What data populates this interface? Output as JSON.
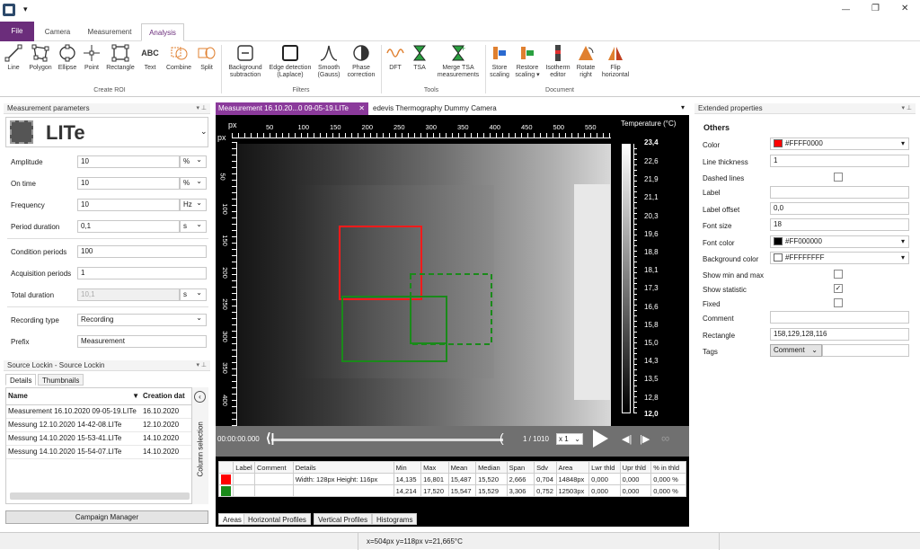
{
  "app": {
    "logo": "app-logo-icon",
    "quick": "▾",
    "controls": {
      "min": "—",
      "max": "❐",
      "close": "✕"
    }
  },
  "menu_tabs": [
    {
      "label": "File"
    },
    {
      "label": "Camera"
    },
    {
      "label": "Measurement"
    },
    {
      "label": "Analysis"
    }
  ],
  "ribbon": {
    "roi": [
      {
        "label": "Line",
        "icon": "line-icon"
      },
      {
        "label": "Polygon",
        "icon": "polygon-icon"
      },
      {
        "label": "Ellipse",
        "icon": "ellipse-icon"
      },
      {
        "label": "Point",
        "icon": "point-icon"
      },
      {
        "label": "Rectangle",
        "icon": "rectangle-icon"
      },
      {
        "label": "Text",
        "icon": "text-icon",
        "glyph": "ABC"
      },
      {
        "label": "Combine",
        "icon": "combine-icon"
      },
      {
        "label": "Split",
        "icon": "split-icon"
      }
    ],
    "roi_group": "Create ROI",
    "filters": [
      {
        "line1": "Background",
        "line2": "subtraction"
      },
      {
        "line1": "Edge detection",
        "line2": "(Laplace)"
      },
      {
        "line1": "Smooth",
        "line2": "(Gauss)"
      },
      {
        "line1": "Phase",
        "line2": "correction"
      }
    ],
    "filters_group": "Filters",
    "tools": [
      {
        "line1": "DFT",
        "line2": ""
      },
      {
        "line1": "TSA",
        "line2": ""
      },
      {
        "line1": "Merge TSA",
        "line2": "measurements"
      }
    ],
    "tools_group": "Tools",
    "document": [
      {
        "line1": "Store",
        "line2": "scaling"
      },
      {
        "line1": "Restore",
        "line2": "scaling ▾"
      },
      {
        "line1": "Isotherm",
        "line2": "editor"
      },
      {
        "line1": "Rotate",
        "line2": "right"
      },
      {
        "line1": "Flip",
        "line2": "horizontal"
      }
    ],
    "document_group": "Document"
  },
  "mp": {
    "header": "Measurement parameters",
    "device": "LITe",
    "fields": {
      "amplitude": {
        "label": "Amplitude",
        "value": "10",
        "unit": "%"
      },
      "ontime": {
        "label": "On time",
        "value": "10",
        "unit": "%"
      },
      "frequency": {
        "label": "Frequency",
        "value": "10",
        "unit": "Hz"
      },
      "period": {
        "label": "Period duration",
        "value": "0,1",
        "unit": "s"
      },
      "condition": {
        "label": "Condition periods",
        "value": "100"
      },
      "acquisition": {
        "label": "Acquisition periods",
        "value": "1"
      },
      "total": {
        "label": "Total duration",
        "value": "10,1",
        "unit": "s"
      },
      "rectype": {
        "label": "Recording type",
        "value": "Recording"
      },
      "prefix": {
        "label": "Prefix",
        "value": "Measurement"
      }
    }
  },
  "src": {
    "header": "Source Lockin - Source Lockin",
    "tabs": [
      "Details",
      "Thumbnails"
    ],
    "col_name": "Name",
    "col_date": "Creation dat",
    "side_label": "Column selection",
    "rows": [
      {
        "name": "Measurement 16.10.2020 09-05-19.LITe",
        "date": "16.10.2020"
      },
      {
        "name": "Messung 12.10.2020 14-42-08.LITe",
        "date": "12.10.2020"
      },
      {
        "name": "Messung 14.10.2020 15-53-41.LITe",
        "date": "14.10.2020"
      },
      {
        "name": "Messung 14.10.2020 15-54-07.LITe",
        "date": "14.10.2020"
      }
    ],
    "campaign": "Campaign Manager"
  },
  "doc_tabs": [
    {
      "label": "Measurement 16.10.20...0 09-05-19.LITe"
    },
    {
      "label": "edevis Thermography Dummy Camera"
    }
  ],
  "viewer": {
    "unit_top": "px",
    "unit_left": "px",
    "x_ticks": [
      "50",
      "100",
      "150",
      "200",
      "250",
      "300",
      "350",
      "400",
      "450",
      "500",
      "550"
    ],
    "y_ticks": [
      "50",
      "100",
      "150",
      "200",
      "250",
      "300",
      "350",
      "400"
    ],
    "temp_title": "Temperature (°C)",
    "temp_max": "23,4",
    "temp_min": "12,0",
    "temp_ticks": [
      "22,6",
      "21,9",
      "21,1",
      "20,3",
      "19,6",
      "18,8",
      "18,1",
      "17,3",
      "16,6",
      "15,8",
      "15,0",
      "14,3",
      "13,5",
      "12,8"
    ],
    "time": "00:00:00.000",
    "frame": "1 / 1010",
    "speed": "x 1"
  },
  "stats": {
    "headers": [
      "",
      "Label",
      "Comment",
      "Details",
      "Min",
      "Max",
      "Mean",
      "Median",
      "Span",
      "Sdv",
      "Area",
      "Lwr thld",
      "Upr thld",
      "% in thld"
    ],
    "rows": [
      {
        "color": "#FF0000",
        "label": "",
        "comment": "",
        "details": "Width: 128px Height: 116px",
        "min": "14,135",
        "max": "16,801",
        "mean": "15,487",
        "median": "15,520",
        "span": "2,666",
        "sdv": "0,704",
        "area": "14848px",
        "lwr": "0,000",
        "upr": "0,000",
        "pct": "0,000 %"
      },
      {
        "color": "#1a8a1a",
        "label": "",
        "comment": "",
        "details": "",
        "min": "14,214",
        "max": "17,520",
        "mean": "15,547",
        "median": "15,529",
        "span": "3,306",
        "sdv": "0,752",
        "area": "12503px",
        "lwr": "0,000",
        "upr": "0,000",
        "pct": "0,000 %"
      }
    ],
    "tabs": [
      "Areas",
      "Horizontal Profiles",
      "Vertical Profiles",
      "Histograms"
    ]
  },
  "ep": {
    "header": "Extended properties",
    "section": "Others",
    "color": {
      "label": "Color",
      "value": "#FFFF0000",
      "swatch": "#FF0000"
    },
    "thickness": {
      "label": "Line thickness",
      "value": "1"
    },
    "dashed": {
      "label": "Dashed lines"
    },
    "labelf": {
      "label": "Label",
      "value": ""
    },
    "offset": {
      "label": "Label offset",
      "value": "0,0"
    },
    "fontsize": {
      "label": "Font size",
      "value": "18"
    },
    "fontcolor": {
      "label": "Font color",
      "value": "#FF000000",
      "swatch": "#000000"
    },
    "bgcolor": {
      "label": "Background color",
      "value": "#FFFFFFFF",
      "swatch": "#FFFFFF"
    },
    "minmax": {
      "label": "Show min and max"
    },
    "statistic": {
      "label": "Show statistic",
      "mark": "✓"
    },
    "fixed": {
      "label": "Fixed"
    },
    "comment": {
      "label": "Comment",
      "value": ""
    },
    "rect": {
      "label": "Rectangle",
      "value": "158,129,128,116"
    },
    "tags": {
      "label": "Tags",
      "value": "Comment"
    }
  },
  "status": {
    "text": "x=504px y=118px v=21,665°C"
  }
}
